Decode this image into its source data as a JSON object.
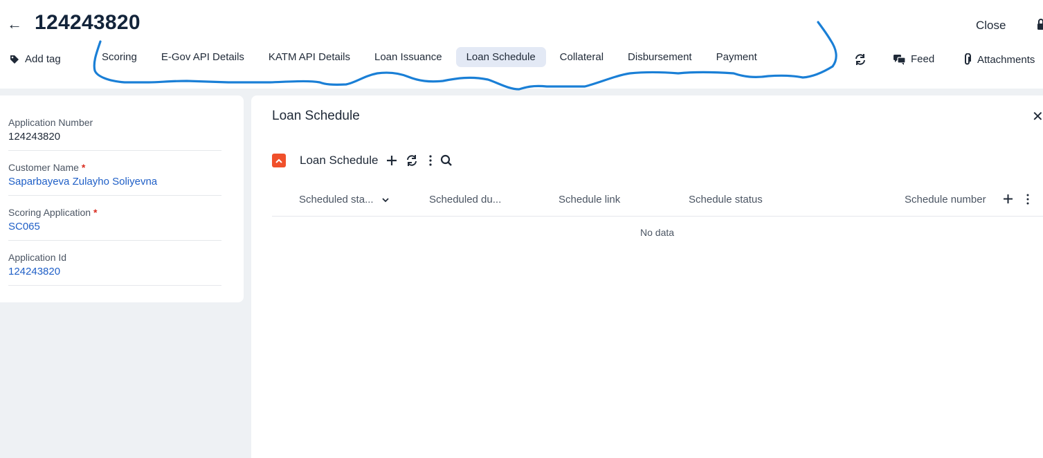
{
  "header": {
    "title": "124243820",
    "close_label": "Close",
    "add_tag_label": "Add tag"
  },
  "tabs": [
    {
      "label": "Scoring"
    },
    {
      "label": "E-Gov API Details"
    },
    {
      "label": "KATM API Details"
    },
    {
      "label": "Loan Issuance"
    },
    {
      "label": "Loan Schedule",
      "active": true
    },
    {
      "label": "Collateral"
    },
    {
      "label": "Disbursement"
    },
    {
      "label": "Payment"
    }
  ],
  "toolbar": {
    "feed_label": "Feed",
    "attachments_label": "Attachments"
  },
  "details": {
    "application_number": {
      "label": "Application Number",
      "value": "124243820"
    },
    "customer_name": {
      "label": "Customer Name",
      "value": "Saparbayeva Zulayho Soliyevna"
    },
    "scoring_application": {
      "label": "Scoring Application",
      "value": "SC065"
    },
    "application_id": {
      "label": "Application Id",
      "value": "124243820"
    },
    "required_mark": "*"
  },
  "panel": {
    "title": "Loan Schedule",
    "section_title": "Loan Schedule",
    "columns": [
      "Scheduled sta...",
      "Scheduled du...",
      "Schedule link",
      "Schedule status",
      "Schedule number"
    ],
    "empty_text": "No data"
  },
  "colors": {
    "accent_link": "#1f5fc7",
    "active_tab_bg": "#e3e9f5",
    "collapse_toggle": "#f0502b",
    "annotation_stroke": "#1a7fd6"
  },
  "icons": [
    "back-arrow-icon",
    "tag-icon",
    "refresh-icon",
    "feed-icon",
    "paperclip-icon",
    "lock-icon",
    "plus-icon",
    "more-vertical-icon",
    "search-icon",
    "chevron-up-icon",
    "chevron-down-icon",
    "close-icon"
  ]
}
